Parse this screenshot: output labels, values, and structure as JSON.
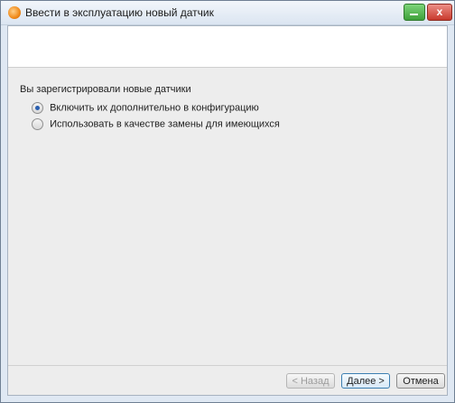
{
  "window": {
    "title": "Ввести в эксплуатацию новый датчик",
    "app_icon": "testo-logo-icon",
    "close_label": "x"
  },
  "content": {
    "question": "Вы зарегистрировали новые датчики",
    "options": [
      {
        "label": "Включить их дополнительно в конфигурацию",
        "selected": true
      },
      {
        "label": "Использовать в качестве замены для имеющихся",
        "selected": false
      }
    ]
  },
  "buttons": {
    "back": "< Назад",
    "next": "Далее >",
    "cancel": "Отмена"
  },
  "colors": {
    "primary_focus_border": "#3c7fb1",
    "radio_selected": "#2a5fb0",
    "close_button": "#c83a2d",
    "minimize_button": "#3ea03a"
  }
}
